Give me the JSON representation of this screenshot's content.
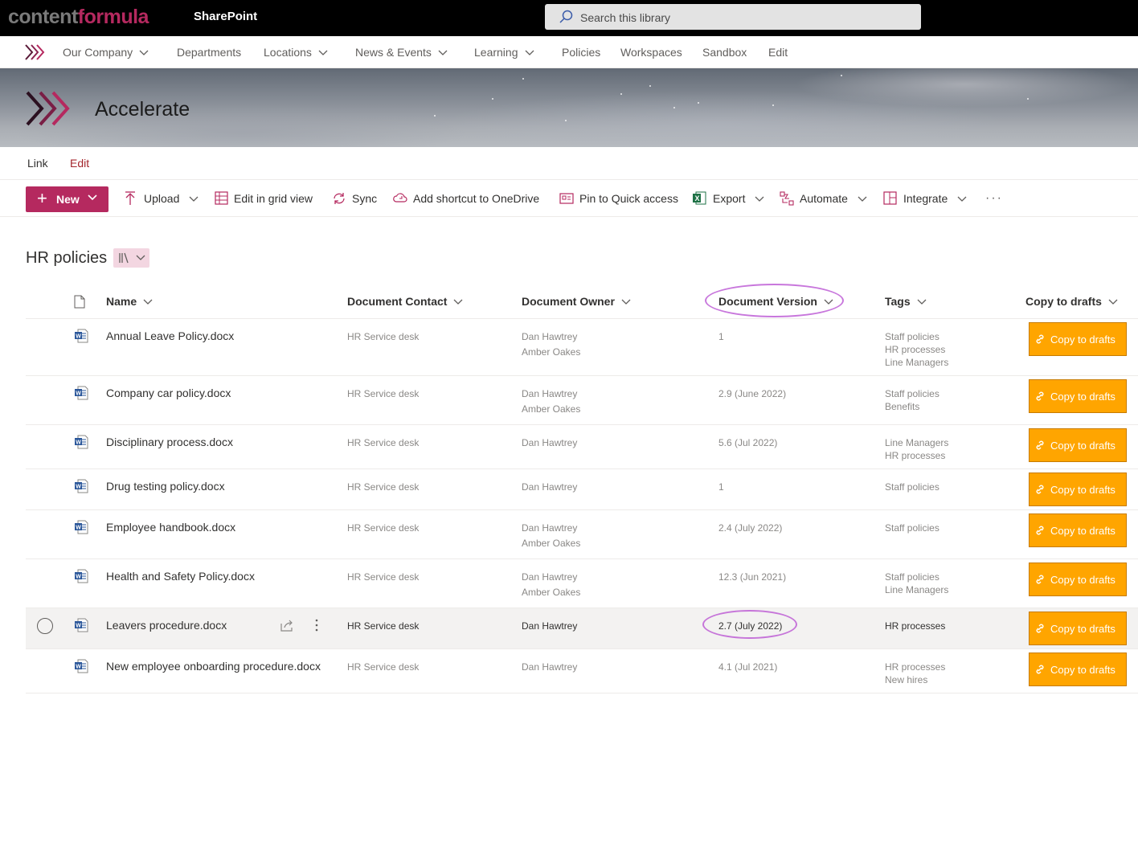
{
  "suite": {
    "brand_part1": "content",
    "brand_part2": "formula",
    "app_name": "SharePoint",
    "search_placeholder": "Search this library"
  },
  "hub_nav": {
    "items": [
      {
        "label": "Our Company",
        "dropdown": true
      },
      {
        "label": "Departments",
        "dropdown": false
      },
      {
        "label": "Locations",
        "dropdown": true
      },
      {
        "label": "News & Events",
        "dropdown": true
      },
      {
        "label": "Learning",
        "dropdown": true
      },
      {
        "label": "Policies",
        "dropdown": false
      },
      {
        "label": "Workspaces",
        "dropdown": false
      },
      {
        "label": "Sandbox",
        "dropdown": false
      },
      {
        "label": "Edit",
        "dropdown": false
      }
    ]
  },
  "site": {
    "title": "Accelerate",
    "nav": [
      "Link",
      "Edit"
    ]
  },
  "command_bar": {
    "new_label": "New",
    "items": [
      "Upload",
      "Edit in grid view",
      "Sync",
      "Add shortcut to OneDrive",
      "Pin to Quick access",
      "Export",
      "Automate",
      "Integrate"
    ],
    "more": "···"
  },
  "library": {
    "title": "HR policies",
    "columns": [
      "Name",
      "Document Contact",
      "Document Owner",
      "Document Version",
      "Tags",
      "Copy to drafts"
    ],
    "copy_label": "Copy to drafts",
    "rows": [
      {
        "name": "Annual Leave Policy.docx",
        "contact": "HR Service desk",
        "owners": [
          "Dan Hawtrey",
          "Amber Oakes"
        ],
        "version": "1",
        "tags": [
          "Staff policies",
          "HR processes",
          "Line Managers"
        ]
      },
      {
        "name": "Company car policy.docx",
        "contact": "HR Service desk",
        "owners": [
          "Dan Hawtrey",
          "Amber Oakes"
        ],
        "version": "2.9 (June 2022)",
        "tags": [
          "Staff policies",
          "Benefits"
        ]
      },
      {
        "name": "Disciplinary process.docx",
        "contact": "HR Service desk",
        "owners": [
          "Dan Hawtrey"
        ],
        "version": "5.6 (Jul 2022)",
        "tags": [
          "Line Managers",
          "HR processes"
        ]
      },
      {
        "name": "Drug testing policy.docx",
        "contact": "HR Service desk",
        "owners": [
          "Dan Hawtrey"
        ],
        "version": "1",
        "tags": [
          "Staff policies"
        ]
      },
      {
        "name": "Employee handbook.docx",
        "contact": "HR Service desk",
        "owners": [
          "Dan Hawtrey",
          "Amber Oakes"
        ],
        "version": "2.4 (July 2022)",
        "tags": [
          "Staff policies"
        ]
      },
      {
        "name": "Health and Safety Policy.docx",
        "contact": "HR Service desk",
        "owners": [
          "Dan Hawtrey",
          "Amber Oakes"
        ],
        "version": "12.3 (Jun 2021)",
        "tags": [
          "Staff policies",
          "Line Managers"
        ]
      },
      {
        "name": "Leavers procedure.docx",
        "contact": "HR Service desk",
        "owners": [
          "Dan Hawtrey"
        ],
        "version": "2.7 (July 2022)",
        "tags": [
          "HR processes"
        ],
        "selected": true
      },
      {
        "name": "New employee onboarding procedure.docx",
        "contact": "HR Service desk",
        "owners": [
          "Dan Hawtrey"
        ],
        "version": "4.1 (Jul 2021)",
        "tags": [
          "HR processes",
          "New hires"
        ]
      }
    ]
  },
  "colors": {
    "brand_accent": "#b5295f",
    "copy_button": "#ffa500",
    "annotation": "#ba55d3"
  }
}
